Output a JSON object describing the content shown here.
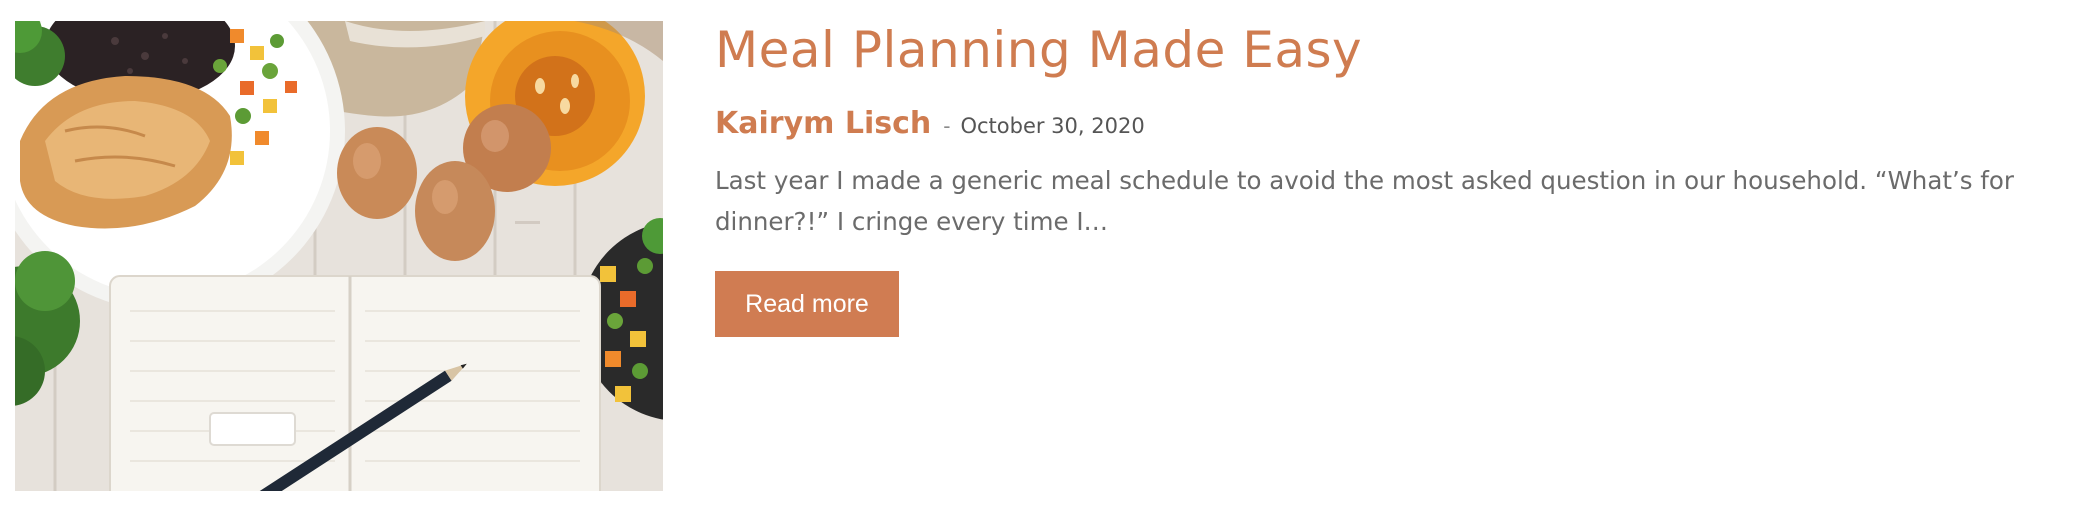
{
  "post": {
    "image_alt": "Meal plan notebook with eggs, chicken and vegetables",
    "title": "Meal Planning Made Easy",
    "author": "Kairym Lisch",
    "separator": "-",
    "date": "October 30, 2020",
    "excerpt": "Last year I made a generic meal schedule to avoid the most asked question in our household. “What’s for dinner?!” I cringe every time I…",
    "read_more_label": "Read more"
  },
  "colors": {
    "accent": "#cf7c50",
    "button": "#d07c52",
    "body_text": "#6b6b6b",
    "date_text": "#555555"
  }
}
